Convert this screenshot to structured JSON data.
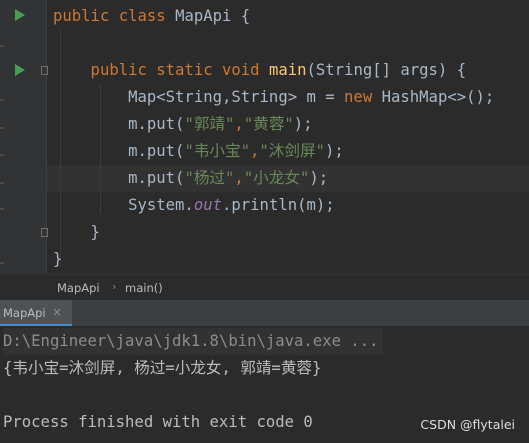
{
  "editor": {
    "lines": [
      {
        "id": "class-decl",
        "tokens": [
          {
            "t": "public class ",
            "c": "kw"
          },
          {
            "t": "MapApi {",
            "c": ""
          }
        ]
      },
      {
        "id": "blank",
        "tokens": []
      },
      {
        "id": "main-decl",
        "tokens": [
          {
            "t": "    public static void ",
            "c": "kw"
          },
          {
            "t": "main",
            "c": "fn"
          },
          {
            "t": "(String[] args) {",
            "c": ""
          }
        ]
      },
      {
        "id": "map-decl",
        "tokens": [
          {
            "t": "        Map<String,String> m = ",
            "c": ""
          },
          {
            "t": "new ",
            "c": "kw"
          },
          {
            "t": "HashMap<>();",
            "c": ""
          }
        ]
      },
      {
        "id": "put-1",
        "tokens": [
          {
            "t": "        m.put(",
            "c": ""
          },
          {
            "t": "\"郭靖\"",
            "c": "str"
          },
          {
            "t": ",",
            "c": "kw"
          },
          {
            "t": "\"黄蓉\"",
            "c": "str"
          },
          {
            "t": ");",
            "c": ""
          }
        ]
      },
      {
        "id": "put-2",
        "tokens": [
          {
            "t": "        m.put(",
            "c": ""
          },
          {
            "t": "\"韦小宝\"",
            "c": "str"
          },
          {
            "t": ",",
            "c": "kw"
          },
          {
            "t": "\"沐剑屏\"",
            "c": "str"
          },
          {
            "t": ");",
            "c": ""
          }
        ]
      },
      {
        "id": "put-3",
        "tokens": [
          {
            "t": "        m.put(",
            "c": ""
          },
          {
            "t": "\"杨过\"",
            "c": "str"
          },
          {
            "t": ",",
            "c": "kw"
          },
          {
            "t": "\"小龙女\"",
            "c": "str"
          },
          {
            "t": ");",
            "c": ""
          }
        ]
      },
      {
        "id": "println",
        "tokens": [
          {
            "t": "        System.",
            "c": ""
          },
          {
            "t": "out",
            "c": "field"
          },
          {
            "t": ".println(m);",
            "c": ""
          }
        ]
      },
      {
        "id": "close-main",
        "tokens": [
          {
            "t": "    }",
            "c": ""
          }
        ]
      },
      {
        "id": "close-class",
        "tokens": [
          {
            "t": "}",
            "c": ""
          }
        ]
      }
    ]
  },
  "breadcrumb": {
    "items": [
      "MapApi",
      "main()"
    ],
    "separator": "›"
  },
  "tool_window": {
    "tab_label": "MapApi",
    "close_glyph": "×"
  },
  "console": {
    "lines": [
      {
        "text": "D:\\Engineer\\java\\jdk1.8\\bin\\java.exe ...",
        "kind": "cmd"
      },
      {
        "text": "{韦小宝=沐剑屏, 杨过=小龙女, 郭靖=黄蓉}",
        "kind": "out"
      },
      {
        "text": "",
        "kind": "out"
      },
      {
        "text": "Process finished with exit code 0",
        "kind": "out"
      }
    ]
  },
  "watermark": "CSDN @flytalei",
  "colors": {
    "keyword": "#cc7832",
    "method": "#ffc66d",
    "string": "#6a8759",
    "field": "#9876aa",
    "text": "#a9b7c6",
    "run_icon": "#499c54"
  }
}
